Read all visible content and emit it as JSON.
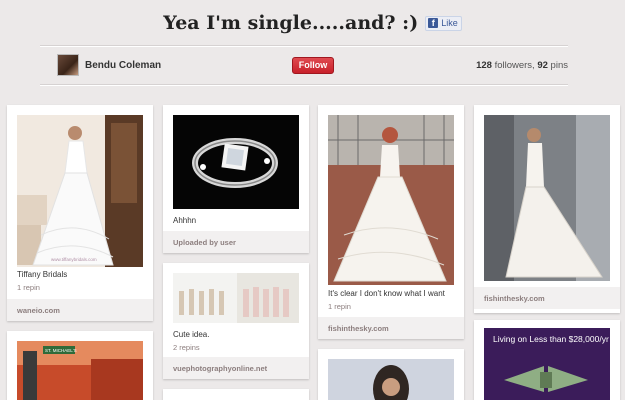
{
  "board": {
    "title": "Yea I'm single.....and? :)",
    "like_label": "Like",
    "like_icon": "f",
    "user_name": "Bendu Coleman",
    "follow_label": "Follow",
    "followers_count": "128",
    "followers_label": " followers, ",
    "pins_count": "92",
    "pins_label": " pins"
  },
  "pins": [
    {
      "description": "Tiffany Bridals",
      "repins": "1 repin",
      "source": "waneio.com",
      "image_watermark": "www.tiffanybridals.com"
    },
    {
      "description": "Ahhhn",
      "repins": "",
      "source": "Uploaded by user"
    },
    {
      "description": "Cute idea.",
      "repins": "2 repins",
      "source": "vuephotographyonline.net"
    },
    {
      "description": "It's clear I don't know what I want",
      "repins": "1 repin",
      "source": "fishinthesky.com"
    },
    {
      "description": "",
      "repins": "",
      "source": "fishinthesky.com"
    },
    {
      "description": "",
      "repins": "",
      "source": "",
      "street_sign": "ST. MICHAEL'S"
    },
    {
      "description": "",
      "repins": "",
      "source": "",
      "ad_text": "Living on Less than $28,000/yr"
    }
  ],
  "colors": {
    "follow_button": "#cb2027",
    "background": "#ece9e9",
    "ad_purple": "#3b1c5a"
  }
}
